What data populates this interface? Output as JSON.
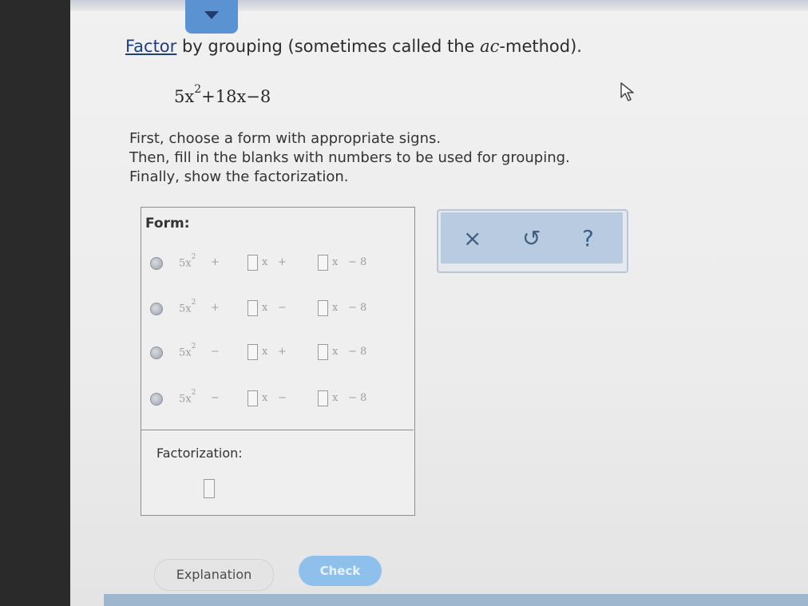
{
  "question": {
    "link": "Factor",
    "text_before_em": " by grouping (sometimes called the ",
    "em": "ac",
    "text_after_em": "-method)."
  },
  "expression": {
    "coef": "5x",
    "exp": "2",
    "rest": "+18x−8"
  },
  "instructions": [
    "First, choose a form with appropriate signs.",
    "Then, fill in the blanks with numbers to be used for grouping.",
    "Finally, show the factorization."
  ],
  "form": {
    "label": "Form:",
    "options": [
      {
        "lead": "5x",
        "exp": "2",
        "op1": "+",
        "op2": "+",
        "tail": "− 8"
      },
      {
        "lead": "5x",
        "exp": "2",
        "op1": "+",
        "op2": "−",
        "tail": "− 8"
      },
      {
        "lead": "5x",
        "exp": "2",
        "op1": "−",
        "op2": "+",
        "tail": "− 8"
      },
      {
        "lead": "5x",
        "exp": "2",
        "op1": "−",
        "op2": "−",
        "tail": "− 8"
      }
    ],
    "var": "x"
  },
  "factorization": {
    "label": "Factorization:"
  },
  "tools": {
    "clear": "×",
    "undo": "↺",
    "help": "?"
  },
  "buttons": {
    "explanation": "Explanation",
    "check": "Check"
  }
}
